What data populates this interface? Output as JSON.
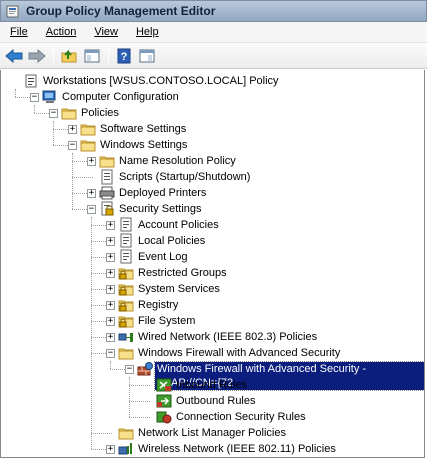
{
  "window": {
    "title": "Group Policy Management Editor"
  },
  "menu": [
    "File",
    "Action",
    "View",
    "Help"
  ],
  "toolbar": {
    "icons": [
      "back-icon",
      "forward-icon",
      "up-folder-icon",
      "show-hide-tree-icon",
      "help-icon",
      "properties-icon"
    ]
  },
  "tree": {
    "items": [
      {
        "label": "Workstations [WSUS.CONTOSO.LOCAL] Policy",
        "depth": 0,
        "expander": "none",
        "icon": "policy-scroll-icon"
      },
      {
        "label": "Computer Configuration",
        "depth": 1,
        "expander": "minus",
        "icon": "computer-icon"
      },
      {
        "label": "Policies",
        "depth": 2,
        "expander": "minus",
        "icon": "folder-icon"
      },
      {
        "label": "Software Settings",
        "depth": 3,
        "expander": "plus",
        "icon": "folder-icon"
      },
      {
        "label": "Windows Settings",
        "depth": 3,
        "expander": "minus",
        "icon": "folder-icon"
      },
      {
        "label": "Name Resolution Policy",
        "depth": 4,
        "expander": "plus",
        "icon": "folder-icon"
      },
      {
        "label": "Scripts (Startup/Shutdown)",
        "depth": 4,
        "expander": "none",
        "icon": "script-icon"
      },
      {
        "label": "Deployed Printers",
        "depth": 4,
        "expander": "plus",
        "icon": "printer-icon"
      },
      {
        "label": "Security Settings",
        "depth": 4,
        "expander": "minus",
        "icon": "security-settings-icon"
      },
      {
        "label": "Account Policies",
        "depth": 5,
        "expander": "plus",
        "icon": "policy-doc-icon"
      },
      {
        "label": "Local Policies",
        "depth": 5,
        "expander": "plus",
        "icon": "policy-doc-icon"
      },
      {
        "label": "Event Log",
        "depth": 5,
        "expander": "plus",
        "icon": "policy-doc-icon"
      },
      {
        "label": "Restricted Groups",
        "depth": 5,
        "expander": "plus",
        "icon": "locked-folder-icon"
      },
      {
        "label": "System Services",
        "depth": 5,
        "expander": "plus",
        "icon": "locked-folder-icon"
      },
      {
        "label": "Registry",
        "depth": 5,
        "expander": "plus",
        "icon": "locked-folder-icon"
      },
      {
        "label": "File System",
        "depth": 5,
        "expander": "plus",
        "icon": "locked-folder-icon"
      },
      {
        "label": "Wired Network (IEEE 802.3) Policies",
        "depth": 5,
        "expander": "plus",
        "icon": "wired-network-icon"
      },
      {
        "label": "Windows Firewall with Advanced Security",
        "depth": 5,
        "expander": "minus",
        "icon": "folder-icon"
      },
      {
        "label": "Windows Firewall with Advanced Security - LDAP://CN={72",
        "depth": 6,
        "expander": "minus",
        "icon": "firewall-icon",
        "selected": true
      },
      {
        "label": "Inbound Rules",
        "depth": 7,
        "expander": "none",
        "icon": "inbound-rules-icon"
      },
      {
        "label": "Outbound Rules",
        "depth": 7,
        "expander": "none",
        "icon": "outbound-rules-icon"
      },
      {
        "label": "Connection Security Rules",
        "depth": 7,
        "expander": "none",
        "icon": "connection-security-icon"
      },
      {
        "label": "Network List Manager Policies",
        "depth": 5,
        "expander": "none",
        "icon": "folder-icon"
      },
      {
        "label": "Wireless Network (IEEE 802.11) Policies",
        "depth": 5,
        "expander": "plus",
        "icon": "wireless-network-icon"
      }
    ]
  },
  "colors": {
    "selection": "#0b1e7e",
    "folder": "#f2cf5b"
  }
}
